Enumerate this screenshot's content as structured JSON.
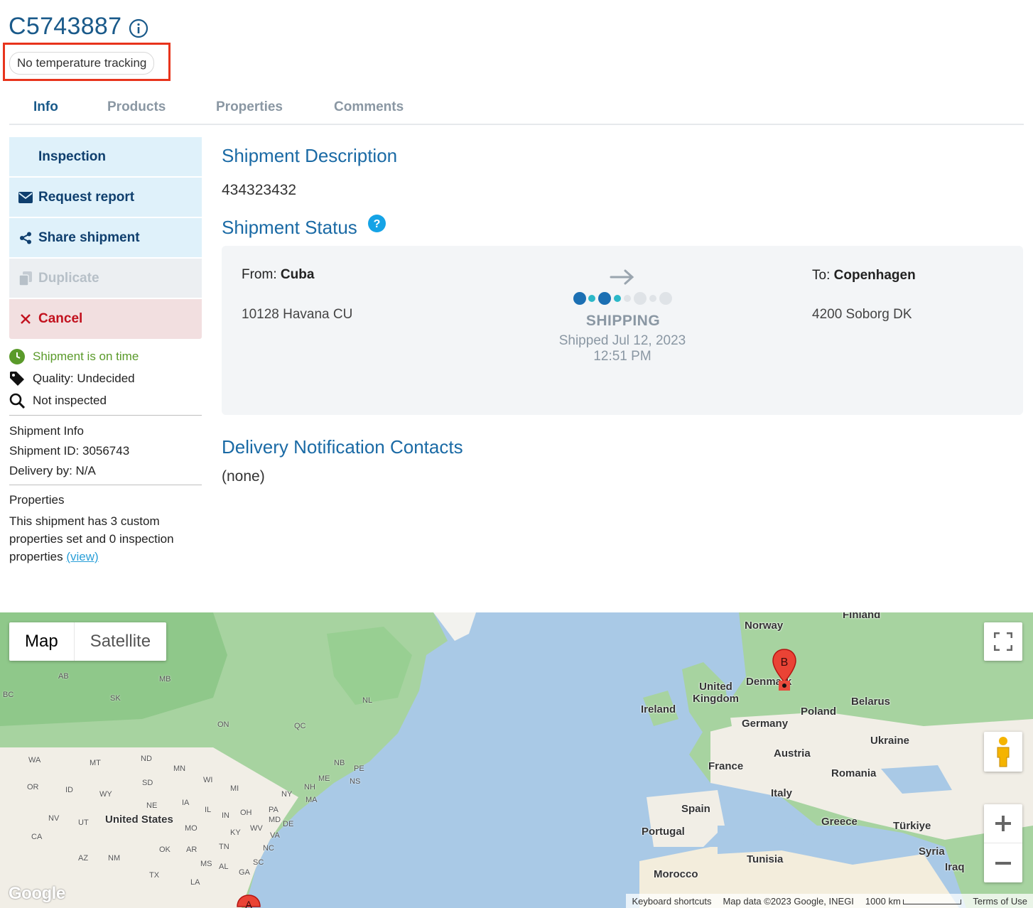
{
  "header": {
    "title": "C5743887",
    "tag": "No temperature tracking"
  },
  "tabs": [
    {
      "label": "Info",
      "active": true
    },
    {
      "label": "Products",
      "active": false
    },
    {
      "label": "Properties",
      "active": false
    },
    {
      "label": "Comments",
      "active": false
    }
  ],
  "actions": {
    "inspection": "Inspection",
    "request_report": "Request report",
    "share_shipment": "Share shipment",
    "duplicate": "Duplicate",
    "cancel": "Cancel"
  },
  "status_items": {
    "on_time": "Shipment is on time",
    "quality": "Quality: Undecided",
    "inspected": "Not inspected"
  },
  "shipment_info": {
    "heading": "Shipment Info",
    "id": "Shipment ID: 3056743",
    "delivery": "Delivery by: N/A"
  },
  "properties_info": {
    "heading": "Properties",
    "line1": "This shipment has 3 custom",
    "line2": "properties set and 0 inspection",
    "line3": "properties",
    "link": "(view)"
  },
  "main": {
    "description_heading": "Shipment Description",
    "description_value": "434323432",
    "status_heading": "Shipment Status",
    "contacts_heading": "Delivery Notification Contacts",
    "contacts_value": "(none)"
  },
  "status_card": {
    "from_label": "From:",
    "from_value": "Cuba",
    "from_address": "10128 Havana CU",
    "to_label": "To:",
    "to_value": "Copenhagen",
    "to_address": "4200 Soborg DK",
    "status": "SHIPPING",
    "shipped_line1": "Shipped Jul 12, 2023",
    "shipped_line2": "12:51 PM"
  },
  "map": {
    "type_map": "Map",
    "type_satellite": "Satellite",
    "marker_a": "A",
    "marker_b": "B",
    "labels": {
      "norway": "Norway",
      "finland": "Finland",
      "united_kingdom_1": "United",
      "united_kingdom_2": "Kingdom",
      "ireland": "Ireland",
      "denmark": "Denmark",
      "poland": "Poland",
      "belarus": "Belarus",
      "germany": "Germany",
      "ukraine": "Ukraine",
      "austria": "Austria",
      "france": "France",
      "romania": "Romania",
      "italy": "Italy",
      "spain": "Spain",
      "portugal": "Portugal",
      "greece": "Greece",
      "turkiye": "Türkiye",
      "syria": "Syria",
      "iraq": "Iraq",
      "tunisia": "Tunisia",
      "morocco": "Morocco",
      "united_states": "United States"
    },
    "small_labels": [
      "AB",
      "BC",
      "MB",
      "SK",
      "ON",
      "QC",
      "NL",
      "WA",
      "MT",
      "ND",
      "MN",
      "OR",
      "ID",
      "SD",
      "WY",
      "NE",
      "IA",
      "WI",
      "MI",
      "NY",
      "NH",
      "ME",
      "PE",
      "NB",
      "NS",
      "MA",
      "NV",
      "UT",
      "IL",
      "IN",
      "OH",
      "PA",
      "MO",
      "KY",
      "WV",
      "VA",
      "DE",
      "MD",
      "CA",
      "AZ",
      "NM",
      "OK",
      "AR",
      "TN",
      "NC",
      "MS",
      "AL",
      "GA",
      "SC",
      "TX",
      "LA"
    ],
    "attribution": {
      "shortcuts": "Keyboard shortcuts",
      "data": "Map data ©2023 Google, INEGI",
      "scale": "1000 km",
      "terms": "Terms of Use"
    },
    "logo": "Google"
  }
}
